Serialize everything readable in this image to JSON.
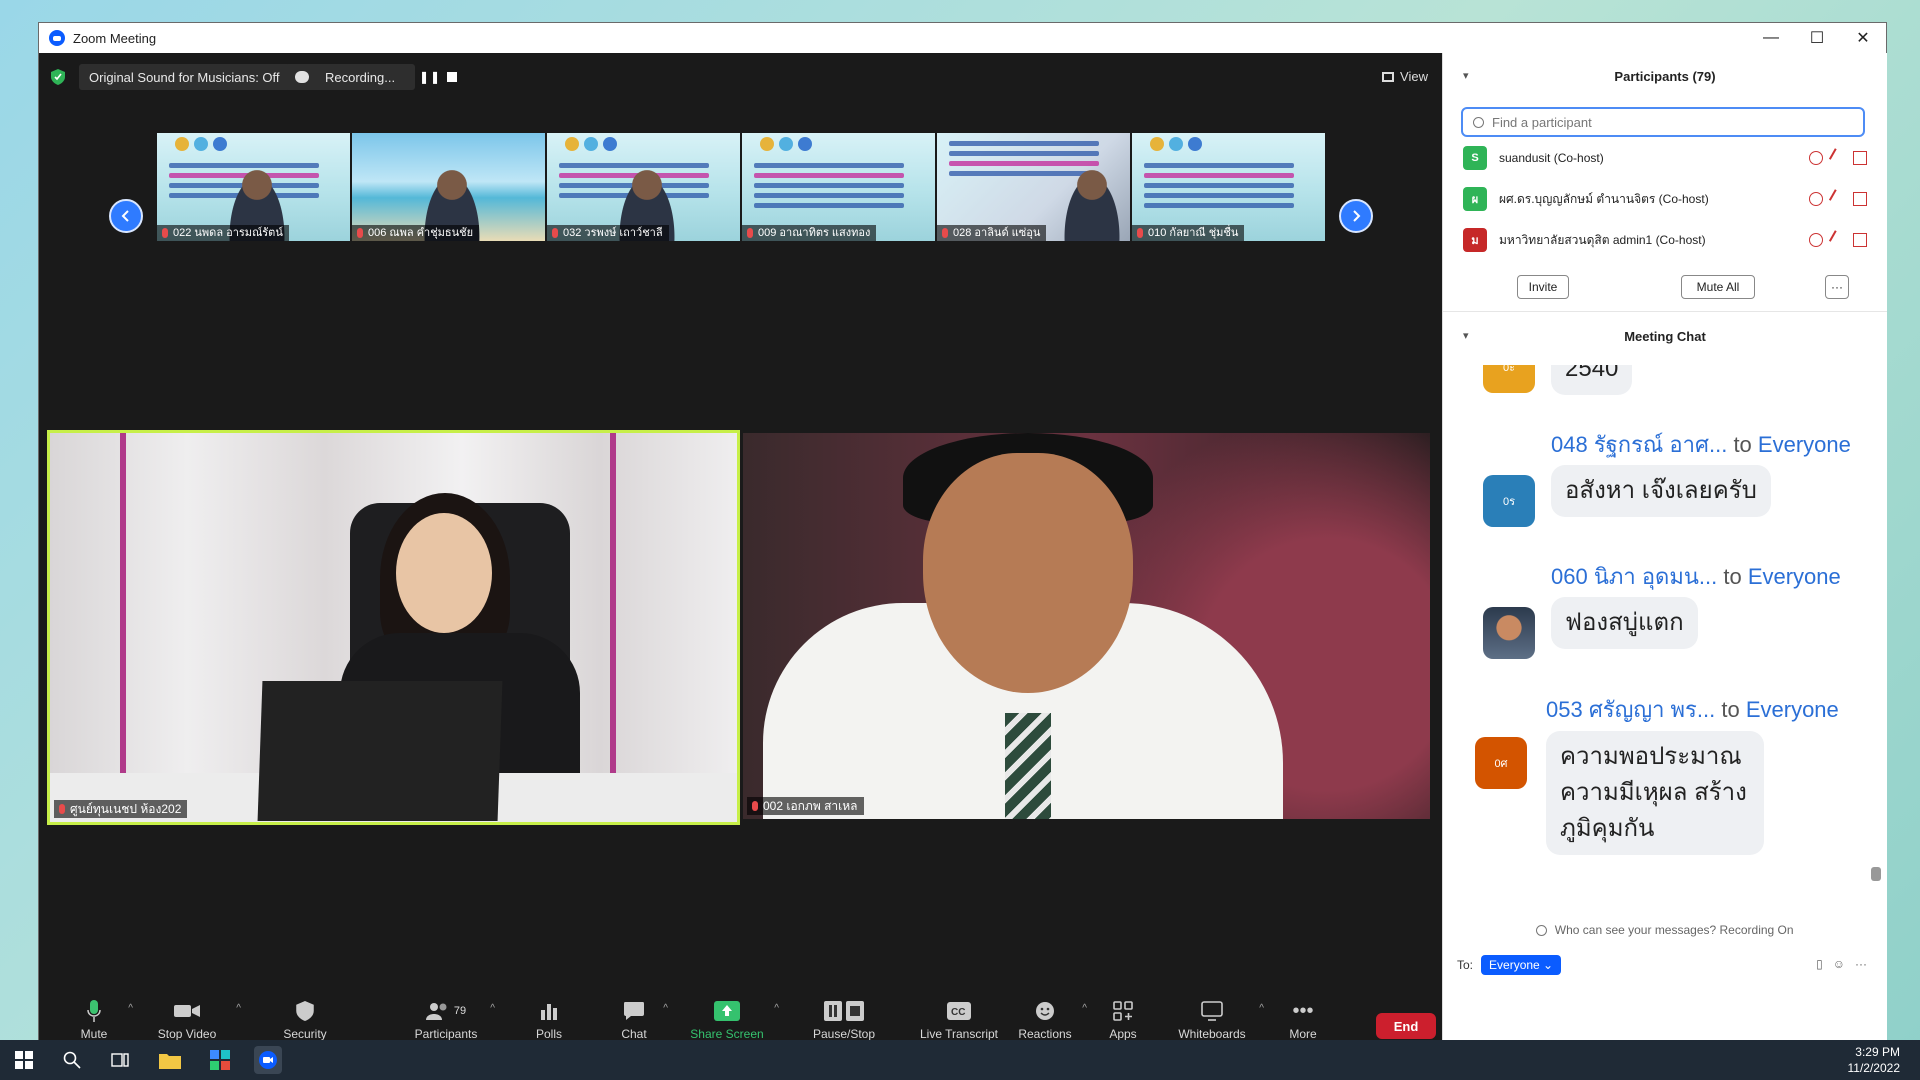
{
  "window": {
    "title": "Zoom Meeting",
    "minimize": "—",
    "maximize": "☐",
    "close": "✕"
  },
  "top_bar": {
    "sound": "Original Sound for Musicians: Off",
    "recording": "Recording...",
    "view": "View"
  },
  "thumbnails": [
    {
      "name": "022 นพดล อารมณ์รัตน์"
    },
    {
      "name": "006 ณพล คำชุ่มธนชัย"
    },
    {
      "name": "032 วรพงษ์ เถาว์ชาลี"
    },
    {
      "name": "009 อาณาทิตร แสงทอง"
    },
    {
      "name": "028 อาลินด์ แซ่อุน"
    },
    {
      "name": "010 กัลยาณี ชุ่มชื่น"
    }
  ],
  "videos": [
    {
      "name": "ศูนย์ทุนเนชป ห้อง202"
    },
    {
      "name": "002 เอกภพ สาเหล"
    }
  ],
  "toolbar": {
    "mute": "Mute",
    "stop_video": "Stop Video",
    "security": "Security",
    "participants": "Participants",
    "participants_count": "79",
    "polls": "Polls",
    "chat": "Chat",
    "share_screen": "Share Screen",
    "pause_stop": "Pause/Stop Recording",
    "live_transcript": "Live Transcript",
    "reactions": "Reactions",
    "apps": "Apps",
    "whiteboards": "Whiteboards",
    "more": "More",
    "end": "End"
  },
  "participants_panel": {
    "title": "Participants (79)",
    "search_placeholder": "Find a participant",
    "rows": [
      {
        "initial": "S",
        "name": "suandusit (Co-host)",
        "color": "#2fb457"
      },
      {
        "initial": "ผ",
        "name": "ผศ.ดร.บุญญลักษม์ ตำนานจิตร (Co-host)",
        "color": "#2fb457"
      },
      {
        "initial": "ม",
        "name": "มหาวิทยาลัยสวนดุสิต admin1 (Co-host)",
        "color": "#c62828"
      }
    ],
    "invite": "Invite",
    "mute_all": "Mute All",
    "more": "···"
  },
  "chat_panel": {
    "title": "Meeting Chat",
    "messages": [
      {
        "avatar": "0ะ",
        "avatar_color": "#e8a21f",
        "sender": "",
        "to": "",
        "recipient": "",
        "text": "2540"
      },
      {
        "avatar": "0ร",
        "avatar_color": "#2a7fb8",
        "sender": "048 รัฐกรณ์ อาศ...",
        "to": "to",
        "recipient": "Everyone",
        "text": "อสังหา เจ๊งเลยครับ"
      },
      {
        "avatar": "",
        "avatar_color": "#455a64",
        "sender": "060 นิภา อุดมน...",
        "to": "to",
        "recipient": "Everyone",
        "text": "ฟองสบู่แตก"
      },
      {
        "avatar": "0ศ",
        "avatar_color": "#d35400",
        "sender": "053 ศรัญญา พร...",
        "to": "to",
        "recipient": "Everyone",
        "text_lines": [
          "ความพอประมาณ",
          "ความมีเหุผล สร้าง",
          "ภูมิคุมกัน"
        ]
      }
    ],
    "notice": "Who can see your messages? Recording On",
    "to_label": "To:",
    "to_value": "Everyone"
  },
  "taskbar": {
    "time": "3:29 PM",
    "date": "11/2/2022"
  }
}
